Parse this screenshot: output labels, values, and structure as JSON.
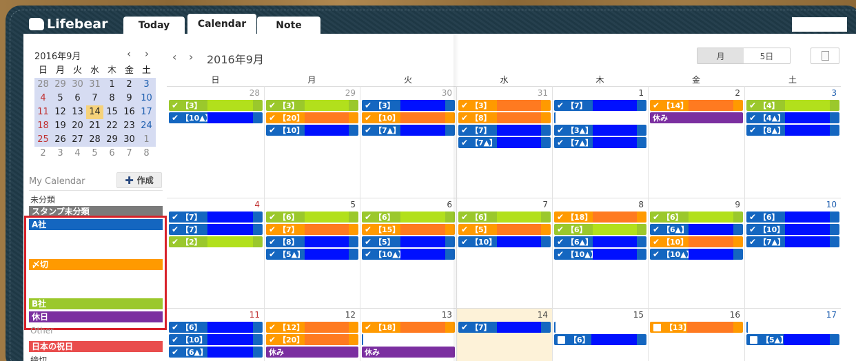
{
  "app": {
    "logo_text": "Lifebear",
    "tabs": [
      {
        "label": "Today"
      },
      {
        "label": "Calendar"
      },
      {
        "label": "Note"
      }
    ]
  },
  "mini_calendar": {
    "title": "2016年9月",
    "prev": "‹",
    "next": "›",
    "weekdays": [
      "日",
      "月",
      "火",
      "水",
      "木",
      "金",
      "土"
    ],
    "weeks": [
      [
        "28",
        "29",
        "30",
        "31",
        "1",
        "2",
        "3"
      ],
      [
        "4",
        "5",
        "6",
        "7",
        "8",
        "9",
        "10"
      ],
      [
        "11",
        "12",
        "13",
        "14",
        "15",
        "16",
        "17"
      ],
      [
        "18",
        "19",
        "20",
        "21",
        "22",
        "23",
        "24"
      ],
      [
        "25",
        "26",
        "27",
        "28",
        "29",
        "30",
        "1"
      ],
      [
        "2",
        "3",
        "4",
        "5",
        "6",
        "7",
        "8"
      ]
    ],
    "today": "14"
  },
  "my_calendar": {
    "label": "My Calendar",
    "create_label": "作成",
    "uncategorized_label": "未分類",
    "items": [
      {
        "label": "スタンプ未分類",
        "color": "#7a7a7a"
      },
      {
        "label": "A社",
        "color": "#1466c0"
      },
      {
        "label": "〆切",
        "color": "#ff9a00"
      },
      {
        "label": "B社",
        "color": "#9bc82c"
      },
      {
        "label": "休日",
        "color": "#7b2fa0"
      }
    ],
    "other_label": "Other",
    "other_items": [
      {
        "label": "日本の祝日",
        "color": "#e94d4d"
      },
      {
        "label": "締切"
      }
    ]
  },
  "calendar": {
    "title": "2016年9月",
    "prev": "‹",
    "next": "›",
    "view_month": "月",
    "view_5day": "5日",
    "weekdays": [
      "日",
      "月",
      "火",
      "水",
      "木",
      "金",
      "土"
    ],
    "weeks": [
      {
        "days": [
          "28",
          "29",
          "30",
          "31",
          "1",
          "2",
          "3"
        ],
        "events": [
          [
            {
              "t": "【3】",
              "c": "g"
            },
            {
              "t": "【10▲】",
              "c": "b"
            }
          ],
          [
            {
              "t": "【3】",
              "c": "g"
            },
            {
              "t": "【20】",
              "c": "o"
            },
            {
              "t": "【10】",
              "c": "b"
            }
          ],
          [
            {
              "t": "【3】",
              "c": "b"
            },
            {
              "t": "【10】",
              "c": "o"
            },
            {
              "t": "【7▲】",
              "c": "b"
            }
          ],
          [
            {
              "t": "【3】",
              "c": "o"
            },
            {
              "t": "【8】",
              "c": "o"
            },
            {
              "t": "【7】",
              "c": "b"
            },
            {
              "t": "【7▲】",
              "c": "b"
            }
          ],
          [
            {
              "t": "【7】",
              "c": "b"
            },
            {
              "t": "",
              "c": "x"
            },
            {
              "t": "【3▲】",
              "c": "b"
            },
            {
              "t": "【7▲】",
              "c": "b"
            }
          ],
          [
            {
              "t": "【14】",
              "c": "o"
            },
            {
              "t": "休み",
              "c": "p"
            }
          ],
          [
            {
              "t": "【4】",
              "c": "g"
            },
            {
              "t": "【4▲】",
              "c": "b"
            },
            {
              "t": "【8▲】",
              "c": "b"
            }
          ]
        ]
      },
      {
        "days": [
          "4",
          "5",
          "6",
          "7",
          "8",
          "9",
          "10"
        ],
        "events": [
          [
            {
              "t": "【7】",
              "c": "b"
            },
            {
              "t": "【7】",
              "c": "b"
            },
            {
              "t": "【2】",
              "c": "g"
            }
          ],
          [
            {
              "t": "【6】",
              "c": "g"
            },
            {
              "t": "【7】",
              "c": "o"
            },
            {
              "t": "【8】",
              "c": "b"
            },
            {
              "t": "【5▲】",
              "c": "b"
            }
          ],
          [
            {
              "t": "【6】",
              "c": "g"
            },
            {
              "t": "【15】",
              "c": "o"
            },
            {
              "t": "【5】",
              "c": "b"
            },
            {
              "t": "【10▲】",
              "c": "b"
            }
          ],
          [
            {
              "t": "【6】",
              "c": "g"
            },
            {
              "t": "【5】",
              "c": "o"
            },
            {
              "t": "【10】",
              "c": "b"
            }
          ],
          [
            {
              "t": "【18】",
              "c": "o"
            },
            {
              "t": "【6】",
              "c": "g"
            },
            {
              "t": "【6▲】",
              "c": "b"
            },
            {
              "t": "【10▲】",
              "c": "b"
            }
          ],
          [
            {
              "t": "【6】",
              "c": "g"
            },
            {
              "t": "【6▲】",
              "c": "b"
            },
            {
              "t": "【10】",
              "c": "o"
            },
            {
              "t": "【10▲】",
              "c": "b"
            }
          ],
          [
            {
              "t": "【6】",
              "c": "b"
            },
            {
              "t": "【10】",
              "c": "b"
            },
            {
              "t": "【7▲】",
              "c": "b"
            }
          ]
        ]
      },
      {
        "days": [
          "11",
          "12",
          "13",
          "14",
          "15",
          "16",
          "17"
        ],
        "events": [
          [
            {
              "t": "【6】",
              "c": "b"
            },
            {
              "t": "【10】",
              "c": "b"
            },
            {
              "t": "【6▲】",
              "c": "b"
            }
          ],
          [
            {
              "t": "【12】",
              "c": "o"
            },
            {
              "t": "【20】",
              "c": "o"
            },
            {
              "t": "休み",
              "c": "p"
            }
          ],
          [
            {
              "t": "【18】",
              "c": "o"
            },
            {
              "t": "",
              "c": "x"
            },
            {
              "t": "休み",
              "c": "p"
            }
          ],
          [
            {
              "t": "【7】",
              "c": "b"
            }
          ],
          [
            {
              "t": "",
              "c": "x"
            },
            {
              "t": "【6】",
              "c": "bu"
            }
          ],
          [
            {
              "t": "【13】",
              "c": "ou"
            }
          ],
          [
            {
              "t": "",
              "c": "x"
            },
            {
              "t": "【5▲】",
              "c": "bu"
            }
          ]
        ]
      }
    ]
  },
  "colors": {
    "blue": "#1466c0",
    "orange": "#ff9a00",
    "green": "#9bc82c",
    "purple": "#7b2fa0",
    "redact_blue": "#0010ff",
    "redact_green": "#b2e01c",
    "redact_orange": "#ff7a20"
  }
}
